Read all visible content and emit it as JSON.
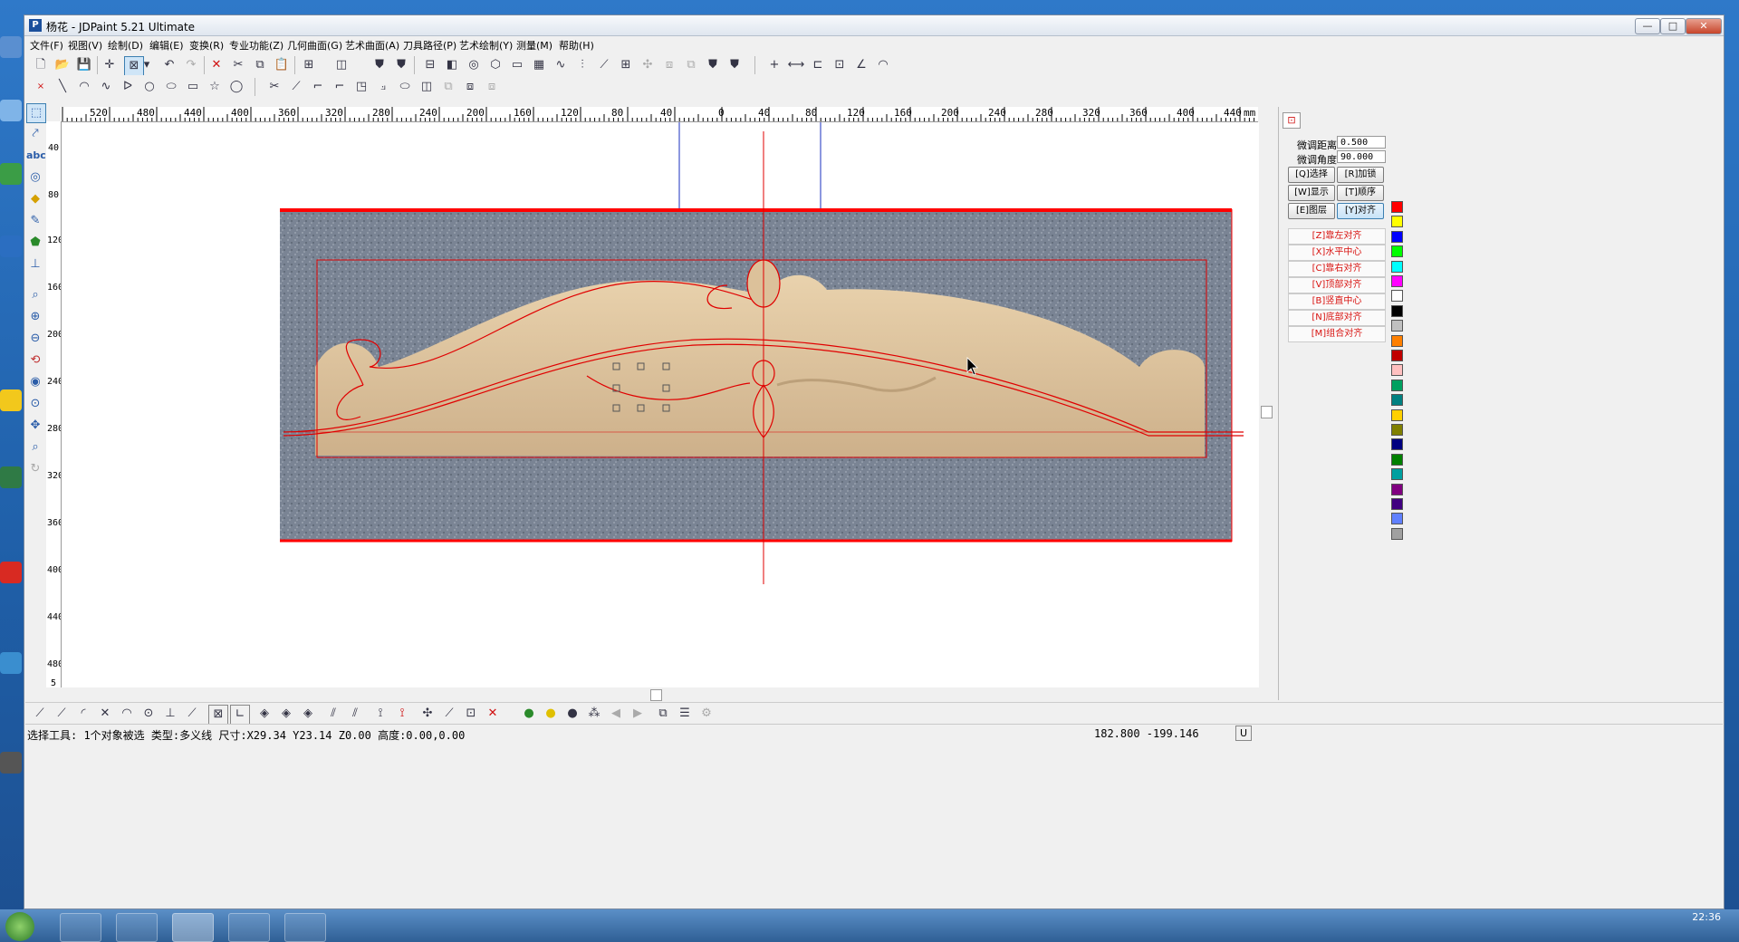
{
  "window": {
    "title": "杨花 - JDPaint 5.21 Ultimate",
    "controls": {
      "minimize": "—",
      "maximize": "□",
      "close": "✕"
    }
  },
  "menu": [
    "文件(F)",
    "视图(V)",
    "绘制(D)",
    "编辑(E)",
    "变换(R)",
    "专业功能(Z)",
    "几何曲面(G)",
    "艺术曲面(A)",
    "刀具路径(P)",
    "艺术绘制(Y)",
    "测量(M)",
    "帮助(H)"
  ],
  "ruler": {
    "h_labels": [
      "520",
      "480",
      "440",
      "400",
      "360",
      "320",
      "280",
      "240",
      "200",
      "160",
      "120",
      "80",
      "40",
      "0",
      "40",
      "80",
      "120",
      "160",
      "200",
      "240",
      "280",
      "320",
      "360",
      "400",
      "440",
      "mm"
    ],
    "v_labels": [
      "40",
      "80",
      "120",
      "160",
      "200",
      "240",
      "280",
      "320",
      "360",
      "400",
      "440",
      "480",
      "5"
    ]
  },
  "panel": {
    "fine_distance_label": "微调距离:",
    "fine_distance_value": "0.500",
    "fine_angle_label": "微调角度:",
    "fine_angle_value": "90.000",
    "buttons": [
      "[Q]选择",
      "[R]加锁",
      "[W]显示",
      "[T]顺序",
      "[E]图层",
      "[Y]对齐"
    ],
    "align": [
      "[Z]靠左对齐",
      "[X]水平中心",
      "[C]靠右对齐",
      "[V]顶部对齐",
      "[B]竖直中心",
      "[N]底部对齐",
      "[M]组合对齐"
    ]
  },
  "palette": [
    "#ff0000",
    "#ffff00",
    "#0000ff",
    "#00ff00",
    "#00ffff",
    "#ff00ff",
    "#ffffff",
    "#000000",
    "#c0c0c0",
    "#ff8000",
    "#c00000",
    "#ffc0c0",
    "#00a060",
    "#008080",
    "#ffd000",
    "#808000",
    "#000080",
    "#008000",
    "#00a0a0",
    "#800080",
    "#400080",
    "#6080ff",
    "#a0a0a0"
  ],
  "status": {
    "text": "选择工具: 1个对象被选 类型:多义线 尺寸:X29.34 Y23.14 Z0.00 高度:0.00,0.00",
    "coords": "182.800 -199.146",
    "unit": "U"
  },
  "clock": "22:36"
}
